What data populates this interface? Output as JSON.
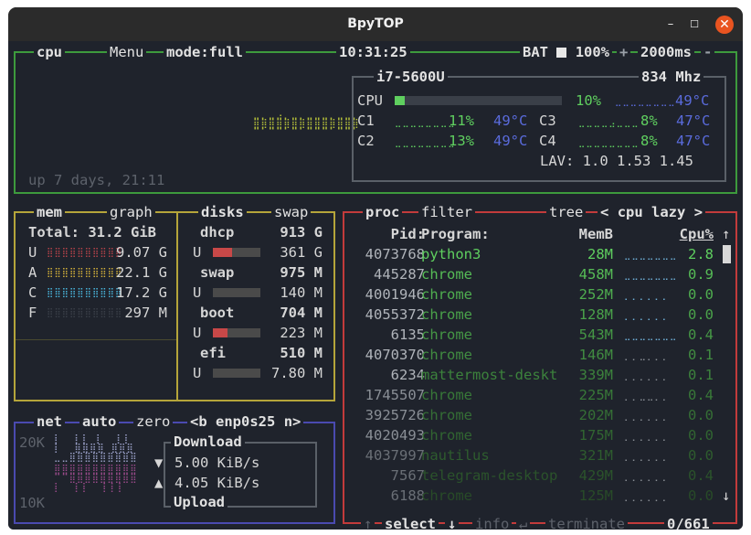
{
  "window": {
    "title": "BpyTOP",
    "minimize": "–",
    "maximize": "☐",
    "close": "✕"
  },
  "colors": {
    "bg": "#1f232c",
    "cpu_border": "#3d9a3d",
    "mem_border": "#b5a53a",
    "proc_border": "#c23b3b",
    "net_border": "#4a4ab0",
    "green": "#5fcf5f",
    "blue": "#5a6bdc",
    "dim": "#6a6f78"
  },
  "cpu": {
    "label": "cpu",
    "menu": "Menu",
    "mode": "mode:full",
    "time": "10:31:25",
    "battery_label": "BAT",
    "battery_pct": "100%",
    "plus": "+",
    "refresh": "2000ms",
    "minus": "-",
    "model": "i7-5600U",
    "freq": "834 Mhz",
    "uptime": "up 7 days, 21:11",
    "total": {
      "name": "CPU",
      "pct": "10%",
      "temp": "49°C",
      "level": 0.06
    },
    "cores": [
      {
        "name": "C1",
        "pct": "11%",
        "temp": "49°C"
      },
      {
        "name": "C2",
        "pct": "13%",
        "temp": "49°C"
      },
      {
        "name": "C3",
        "pct": "8%",
        "temp": "47°C"
      },
      {
        "name": "C4",
        "pct": "8%",
        "temp": "47°C"
      }
    ],
    "load_avg": "LAV: 1.0 1.53 1.45"
  },
  "mem": {
    "label": "mem",
    "graph_label": "graph",
    "total": "Total: 31.2 GiB",
    "rows": [
      {
        "key": "U",
        "value": "9.07 G",
        "color": "#b8434a"
      },
      {
        "key": "A",
        "value": "22.1 G",
        "color": "#d6b23a"
      },
      {
        "key": "C",
        "value": "17.2 G",
        "color": "#4ab8e0"
      },
      {
        "key": "F",
        "value": "297 M",
        "color": "#3a3f48"
      }
    ]
  },
  "disks": {
    "label": "disks",
    "swap_label": "swap",
    "items": [
      {
        "name": "dhcp",
        "total": "913 G",
        "u": "U",
        "used": "361 G",
        "level": 0.4
      },
      {
        "name": "swap",
        "total": "975 M",
        "u": "U",
        "used": "140 M",
        "level": 0.0
      },
      {
        "name": "boot",
        "total": "704 M",
        "u": "U",
        "used": "223 M",
        "level": 0.3
      },
      {
        "name": "efi",
        "total": "510 M",
        "u": "U",
        "used": "7.80 M",
        "level": 0.0
      }
    ]
  },
  "net": {
    "label": "net",
    "auto": "auto",
    "zero": "zero",
    "prev": "<b",
    "iface": "enp0s25",
    "next": "n>",
    "top_scale": "20K",
    "bottom_scale": "10K",
    "download_label": "Download",
    "download_arrow": "▼",
    "download": "5.00 KiB/s",
    "upload_arrow": "▲",
    "upload": "4.05 KiB/s",
    "upload_label": "Upload"
  },
  "proc": {
    "label": "proc",
    "filter": "filter",
    "tree": "tree",
    "sort": "cpu lazy",
    "sort_prev": "<",
    "sort_next": ">",
    "headers": {
      "pid": "Pid:",
      "program": "Program:",
      "mem": "MemB",
      "cpu": "Cpu%"
    },
    "up_arrow": "↑",
    "down_arrow": "↓",
    "rows": [
      {
        "pid": "4073768",
        "name": "python3",
        "mem": "28M",
        "cpu": "2.8"
      },
      {
        "pid": "445287",
        "name": "chrome",
        "mem": "458M",
        "cpu": "0.9"
      },
      {
        "pid": "4001946",
        "name": "chrome",
        "mem": "252M",
        "cpu": "0.0"
      },
      {
        "pid": "4055372",
        "name": "chrome",
        "mem": "128M",
        "cpu": "0.0"
      },
      {
        "pid": "6135",
        "name": "chrome",
        "mem": "543M",
        "cpu": "0.4"
      },
      {
        "pid": "4070370",
        "name": "chrome",
        "mem": "146M",
        "cpu": "0.1"
      },
      {
        "pid": "6234",
        "name": "mattermost-deskt",
        "mem": "339M",
        "cpu": "0.1"
      },
      {
        "pid": "1745507",
        "name": "chrome",
        "mem": "225M",
        "cpu": "0.4"
      },
      {
        "pid": "3925726",
        "name": "chrome",
        "mem": "202M",
        "cpu": "0.0"
      },
      {
        "pid": "4020493",
        "name": "chrome",
        "mem": "175M",
        "cpu": "0.0"
      },
      {
        "pid": "4037997",
        "name": "nautilus",
        "mem": "321M",
        "cpu": "0.0"
      },
      {
        "pid": "7567",
        "name": "telegram-desktop",
        "mem": "429M",
        "cpu": "0.4"
      },
      {
        "pid": "6188",
        "name": "chrome",
        "mem": "125M",
        "cpu": "0.0"
      }
    ],
    "footer": {
      "up": "↑",
      "select": "select",
      "down": "↓",
      "info": "info",
      "enter": "↵",
      "terminate": "terminate",
      "count": "0/661"
    }
  }
}
